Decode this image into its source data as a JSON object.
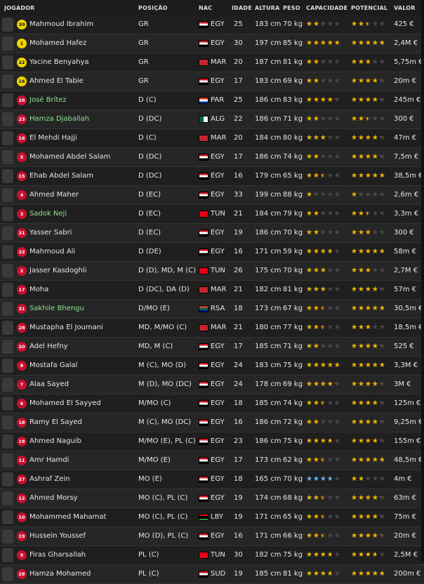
{
  "header": {
    "jogador": "JOGADOR",
    "posicao": "POSIÇÃO",
    "nac": "NAC",
    "idade": "IDADE",
    "altura": "ALTURA",
    "peso": "PESO",
    "capacidade": "CAPACIDADE",
    "potencial": "POTENCIAL",
    "valor": "VALOR"
  },
  "colors": {
    "star": "#f2b400",
    "star_blue": "#5cb6ff",
    "green_name": "#8fe38f"
  },
  "players": [
    {
      "num": "30",
      "gk": true,
      "name": "Mahmoud Ibrahim",
      "green": false,
      "pos": "GR",
      "nac": "EGY",
      "idade": "25",
      "altura": "183 cm",
      "peso": "70 kg",
      "cap": 1.5,
      "pot": 2.0,
      "valor": "425 €",
      "flag": "egy"
    },
    {
      "num": "1",
      "gk": true,
      "name": "Mohamed Hafez",
      "green": false,
      "pos": "GR",
      "nac": "EGY",
      "idade": "30",
      "altura": "197 cm",
      "peso": "85 kg",
      "cap": 4.0,
      "pot": 4.0,
      "valor": "2,4M €",
      "flag": "egy"
    },
    {
      "num": "22",
      "gk": true,
      "name": "Yacine Benyahya",
      "green": false,
      "pos": "GR",
      "nac": "MAR",
      "idade": "20",
      "altura": "187 cm",
      "peso": "81 kg",
      "cap": 1.5,
      "pot": 2.5,
      "valor": "5,75m €",
      "flag": "mar"
    },
    {
      "num": "16",
      "gk": true,
      "name": "Ahmed El Tabie",
      "green": false,
      "pos": "GR",
      "nac": "EGY",
      "idade": "17",
      "altura": "183 cm",
      "peso": "69 kg",
      "cap": 1.5,
      "pot": 3.5,
      "valor": "20m €",
      "flag": "egy"
    },
    {
      "num": "26",
      "gk": false,
      "name": "José Brítez",
      "green": true,
      "pos": "D (C)",
      "nac": "PAR",
      "idade": "25",
      "altura": "186 cm",
      "peso": "83 kg",
      "cap": 3.5,
      "pot": 3.5,
      "valor": "245m €",
      "flag": "par"
    },
    {
      "num": "23",
      "gk": false,
      "name": "Hamza Djaballah",
      "green": true,
      "pos": "D (DC)",
      "nac": "ALG",
      "idade": "22",
      "altura": "186 cm",
      "peso": "71 kg",
      "cap": 1.5,
      "pot": 2.0,
      "valor": "300 €",
      "flag": "alg"
    },
    {
      "num": "16",
      "gk": false,
      "name": "El Mehdi Hajji",
      "green": false,
      "pos": "D (C)",
      "nac": "MAR",
      "idade": "20",
      "altura": "184 cm",
      "peso": "80 kg",
      "cap": 2.5,
      "pot": 3.5,
      "valor": "47m €",
      "flag": "mar"
    },
    {
      "num": "5",
      "gk": false,
      "name": "Mohamed Abdel Salam",
      "green": false,
      "pos": "D (DC)",
      "nac": "EGY",
      "idade": "17",
      "altura": "186 cm",
      "peso": "74 kg",
      "cap": 1.5,
      "pot": 3.5,
      "valor": "7,5m €",
      "flag": "egy"
    },
    {
      "num": "15",
      "gk": false,
      "name": "Ehab Abdel Salam",
      "green": false,
      "pos": "D (DC)",
      "nac": "EGY",
      "idade": "16",
      "altura": "179 cm",
      "peso": "65 kg",
      "cap": 2.0,
      "pot": 4.0,
      "valor": "38,5m €",
      "flag": "egy"
    },
    {
      "num": "4",
      "gk": false,
      "name": "Ahmed Maher",
      "green": false,
      "pos": "D (EC)",
      "nac": "EGY",
      "idade": "33",
      "altura": "199 cm",
      "peso": "88 kg",
      "cap": 1.0,
      "pot": 1.0,
      "valor": "2,6m €",
      "flag": "egy"
    },
    {
      "num": "3",
      "gk": false,
      "name": "Sadok Neji",
      "green": true,
      "pos": "D (EC)",
      "nac": "TUN",
      "idade": "21",
      "altura": "184 cm",
      "peso": "79 kg",
      "cap": 1.5,
      "pot": 2.0,
      "valor": "3,3m €",
      "flag": "tun"
    },
    {
      "num": "21",
      "gk": false,
      "name": "Yasser Sabri",
      "green": false,
      "pos": "D (EC)",
      "nac": "EGY",
      "idade": "19",
      "altura": "186 cm",
      "peso": "70 kg",
      "cap": 1.5,
      "pot": 2.5,
      "valor": "300 €",
      "flag": "egy"
    },
    {
      "num": "22",
      "gk": false,
      "name": "Mahmoud Ali",
      "green": false,
      "pos": "D (DE)",
      "nac": "EGY",
      "idade": "16",
      "altura": "171 cm",
      "peso": "59 kg",
      "cap": 3.0,
      "pot": 4.0,
      "valor": "58m €",
      "flag": "egy"
    },
    {
      "num": "2",
      "gk": false,
      "name": "Jasser Kasdoghli",
      "green": false,
      "pos": "D (D), MD, M (C)",
      "nac": "TUN",
      "idade": "26",
      "altura": "175 cm",
      "peso": "70 kg",
      "cap": 2.5,
      "pot": 2.5,
      "valor": "2,7M €",
      "flag": "tun"
    },
    {
      "num": "17",
      "gk": false,
      "name": "Moha",
      "green": false,
      "pos": "D (DC), DA (D)",
      "nac": "MAR",
      "idade": "21",
      "altura": "182 cm",
      "peso": "81 kg",
      "cap": 2.5,
      "pot": 3.5,
      "valor": "57m €",
      "flag": "mar"
    },
    {
      "num": "31",
      "gk": false,
      "name": "Sakhile Bhengu",
      "green": true,
      "pos": "D/MO (E)",
      "nac": "RSA",
      "idade": "18",
      "altura": "173 cm",
      "peso": "67 kg",
      "cap": 2.0,
      "pot": 4.0,
      "valor": "30,5m €",
      "flag": "rsa"
    },
    {
      "num": "28",
      "gk": false,
      "name": "Mustapha El Joumani",
      "green": false,
      "pos": "MD, M/MO (C)",
      "nac": "MAR",
      "idade": "21",
      "altura": "180 cm",
      "peso": "77 kg",
      "cap": 2.0,
      "pot": 2.5,
      "valor": "18,5m €",
      "flag": "mar"
    },
    {
      "num": "20",
      "gk": false,
      "name": "Adel Hefny",
      "green": false,
      "pos": "MD, M (C)",
      "nac": "EGY",
      "idade": "17",
      "altura": "185 cm",
      "peso": "71 kg",
      "cap": 1.5,
      "pot": 3.5,
      "valor": "525 €",
      "flag": "egy"
    },
    {
      "num": "8",
      "gk": false,
      "name": "Mostafa Galal",
      "green": false,
      "pos": "M (C), MO (D)",
      "nac": "EGY",
      "idade": "24",
      "altura": "183 cm",
      "peso": "75 kg",
      "cap": 4.0,
      "pot": 4.0,
      "valor": "3,3M €",
      "flag": "egy"
    },
    {
      "num": "7",
      "gk": false,
      "name": "Alaa Sayed",
      "green": false,
      "pos": "M (D), MO (DC)",
      "nac": "EGY",
      "idade": "24",
      "altura": "178 cm",
      "peso": "69 kg",
      "cap": 3.5,
      "pot": 3.5,
      "valor": "3M €",
      "flag": "egy"
    },
    {
      "num": "6",
      "gk": false,
      "name": "Mohamed El Sayyed",
      "green": false,
      "pos": "M/MO (C)",
      "nac": "EGY",
      "idade": "18",
      "altura": "185 cm",
      "peso": "74 kg",
      "cap": 2.0,
      "pot": 3.5,
      "valor": "125m €",
      "flag": "egy"
    },
    {
      "num": "18",
      "gk": false,
      "name": "Ramy El Sayed",
      "green": false,
      "pos": "M (C), MO (DC)",
      "nac": "EGY",
      "idade": "16",
      "altura": "186 cm",
      "peso": "72 kg",
      "cap": 1.5,
      "pot": 3.5,
      "valor": "9,25m €",
      "flag": "egy"
    },
    {
      "num": "19",
      "gk": false,
      "name": "Ahmed Naguib",
      "green": false,
      "pos": "M/MO (E), PL (C)",
      "nac": "EGY",
      "idade": "23",
      "altura": "186 cm",
      "peso": "75 kg",
      "cap": 3.0,
      "pot": 3.5,
      "valor": "155m €",
      "flag": "egy"
    },
    {
      "num": "11",
      "gk": false,
      "name": "Amr Hamdi",
      "green": false,
      "pos": "M/MO (E)",
      "nac": "EGY",
      "idade": "17",
      "altura": "173 cm",
      "peso": "62 kg",
      "cap": 2.0,
      "pot": 4.0,
      "valor": "48,5m €",
      "flag": "egy"
    },
    {
      "num": "27",
      "gk": false,
      "name": "Ashraf Zein",
      "green": false,
      "pos": "MO (E)",
      "nac": "EGY",
      "idade": "18",
      "altura": "165 cm",
      "peso": "70 kg",
      "cap": 3.0,
      "pot": 1.5,
      "valor": "4m €",
      "flag": "egy",
      "blue": true
    },
    {
      "num": "12",
      "gk": false,
      "name": "Ahmed Morsy",
      "green": false,
      "pos": "MO (C), PL (C)",
      "nac": "EGY",
      "idade": "19",
      "altura": "174 cm",
      "peso": "68 kg",
      "cap": 2.0,
      "pot": 3.5,
      "valor": "63m €",
      "flag": "egy"
    },
    {
      "num": "10",
      "gk": false,
      "name": "Mohammed Mahamat",
      "green": false,
      "pos": "MO (C), PL (C)",
      "nac": "LBY",
      "idade": "19",
      "altura": "171 cm",
      "peso": "65 kg",
      "cap": 2.0,
      "pot": 3.5,
      "valor": "75m €",
      "flag": "lby"
    },
    {
      "num": "19",
      "gk": false,
      "name": "Hussein Youssef",
      "green": false,
      "pos": "MO (D), PL (C)",
      "nac": "EGY",
      "idade": "16",
      "altura": "171 cm",
      "peso": "66 kg",
      "cap": 2.0,
      "pot": 3.5,
      "valor": "20m €",
      "flag": "egy"
    },
    {
      "num": "9",
      "gk": false,
      "name": "Firas Gharsallah",
      "green": false,
      "pos": "PL (C)",
      "nac": "TUN",
      "idade": "30",
      "altura": "182 cm",
      "peso": "75 kg",
      "cap": 3.0,
      "pot": 3.0,
      "valor": "2,5M €",
      "flag": "tun"
    },
    {
      "num": "29",
      "gk": false,
      "name": "Hamza Mohamed",
      "green": false,
      "pos": "PL (C)",
      "nac": "SUD",
      "idade": "19",
      "altura": "185 cm",
      "peso": "81 kg",
      "cap": 3.0,
      "pot": 4.0,
      "valor": "200m €",
      "flag": "sud"
    }
  ]
}
